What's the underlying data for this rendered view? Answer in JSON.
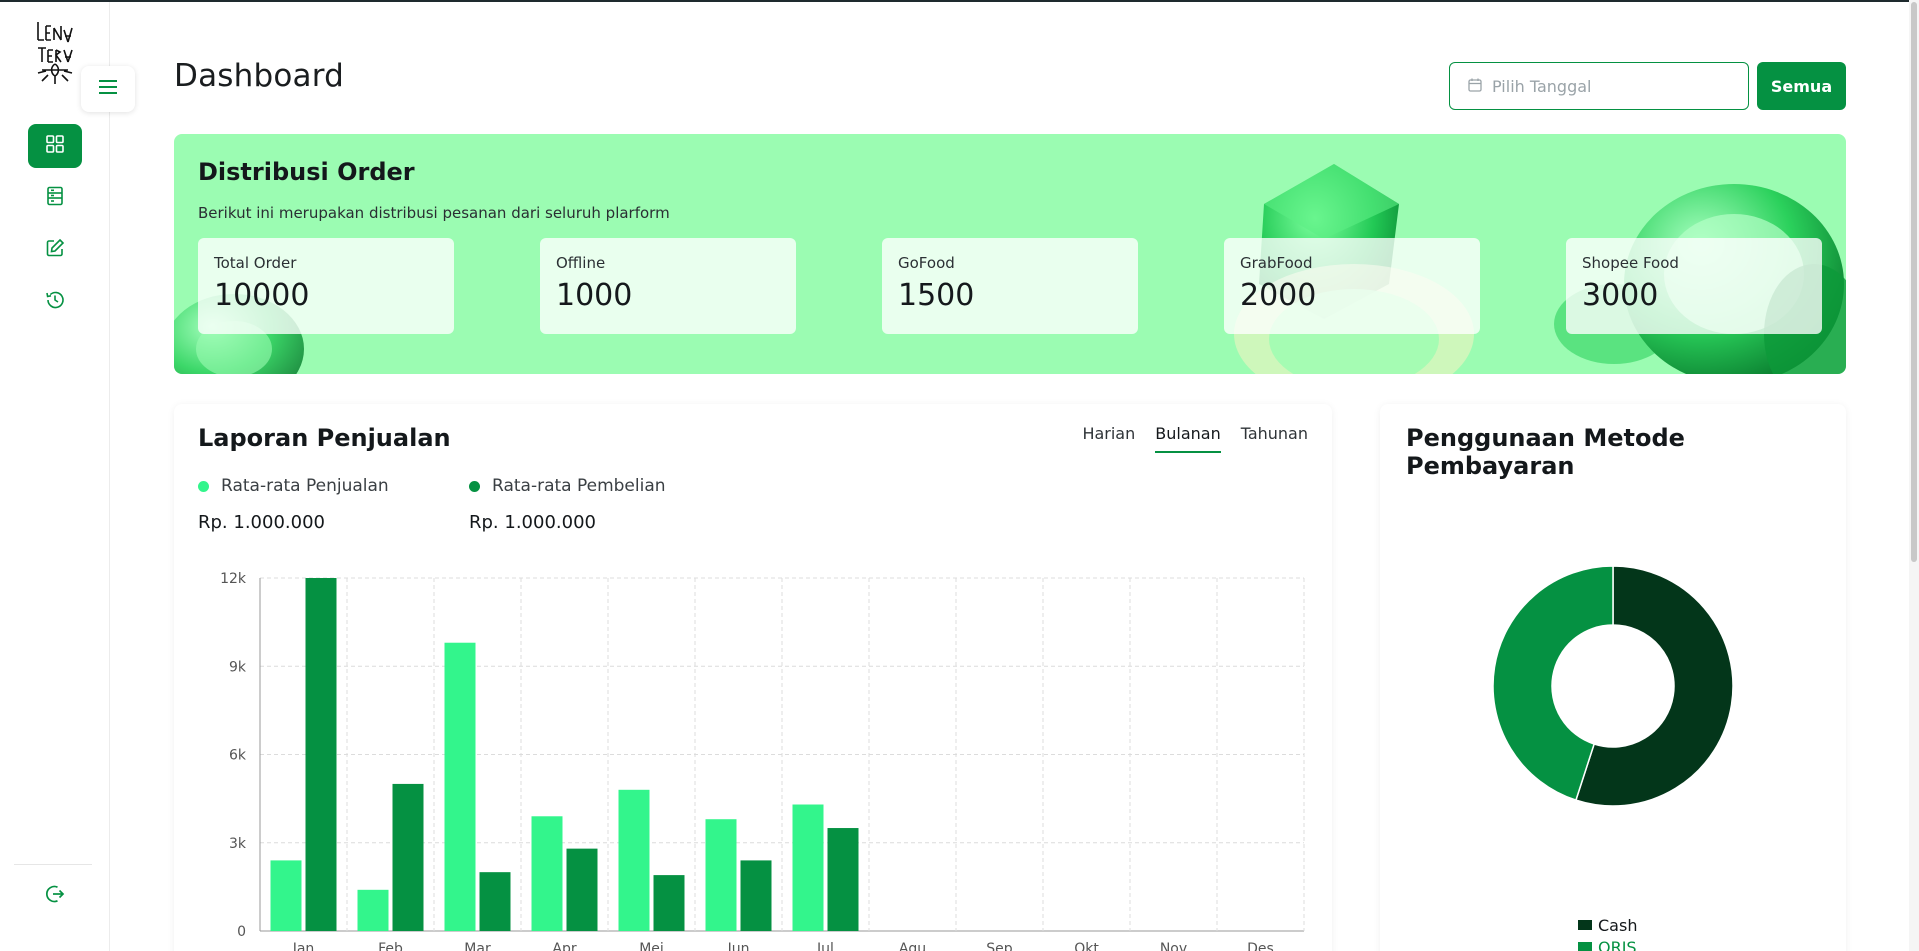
{
  "app": {
    "logo_text": "LENA TERA"
  },
  "sidebar": {
    "items": [
      {
        "name": "dashboard",
        "icon": "grid-icon",
        "active": true
      },
      {
        "name": "reports",
        "icon": "document-list-icon",
        "active": false
      },
      {
        "name": "edit",
        "icon": "edit-icon",
        "active": false
      },
      {
        "name": "history",
        "icon": "history-icon",
        "active": false
      }
    ],
    "logout_icon": "logout-icon"
  },
  "header": {
    "title": "Dashboard",
    "date_placeholder": "Pilih Tanggal",
    "filter_button": "Semua"
  },
  "banner": {
    "title": "Distribusi Order",
    "subtitle": "Berikut ini merupakan distribusi pesanan dari seluruh plarform",
    "stats": [
      {
        "label": "Total Order",
        "value": "10000"
      },
      {
        "label": "Offline",
        "value": "1000"
      },
      {
        "label": "GoFood",
        "value": "1500"
      },
      {
        "label": "GrabFood",
        "value": "2000"
      },
      {
        "label": "Shopee Food",
        "value": "3000"
      }
    ]
  },
  "sales": {
    "title": "Laporan Penjualan",
    "tabs": [
      "Harian",
      "Bulanan",
      "Tahunan"
    ],
    "active_tab": "Bulanan",
    "legend": [
      {
        "label": "Rata-rata Penjualan",
        "value": "Rp. 1.000.000",
        "color": "#33f58c"
      },
      {
        "label": "Rata-rata Pembelian",
        "value": "Rp. 1.000.000",
        "color": "#059142"
      }
    ]
  },
  "payment": {
    "title": "Penggunaan Metode Pembayaran",
    "methods": [
      {
        "label": "Cash",
        "color": "#03361a"
      },
      {
        "label": "QRIS",
        "color": "#059142"
      }
    ]
  },
  "chart_data": [
    {
      "type": "bar",
      "categories": [
        "Jan",
        "Feb",
        "Mar",
        "Apr",
        "Mei",
        "Jun",
        "Jul",
        "Agu",
        "Sep",
        "Okt",
        "Nov",
        "Des"
      ],
      "y_ticks": [
        "0",
        "3k",
        "6k",
        "9k",
        "12k"
      ],
      "ylim": [
        0,
        12000
      ],
      "grid": true,
      "series": [
        {
          "name": "Rata-rata Penjualan",
          "color": "#33f58c",
          "values": [
            2400,
            1400,
            9800,
            3900,
            4800,
            3800,
            4300,
            null,
            null,
            null,
            null,
            null
          ]
        },
        {
          "name": "Rata-rata Pembelian",
          "color": "#059142",
          "values": [
            12000,
            5000,
            2000,
            2800,
            1900,
            2400,
            3500,
            null,
            null,
            null,
            null,
            null
          ]
        }
      ]
    },
    {
      "type": "pie",
      "donut": true,
      "labels": [
        "Cash",
        "QRIS"
      ],
      "values": [
        55,
        45
      ],
      "colors": [
        "#03361a",
        "#059142"
      ]
    }
  ]
}
